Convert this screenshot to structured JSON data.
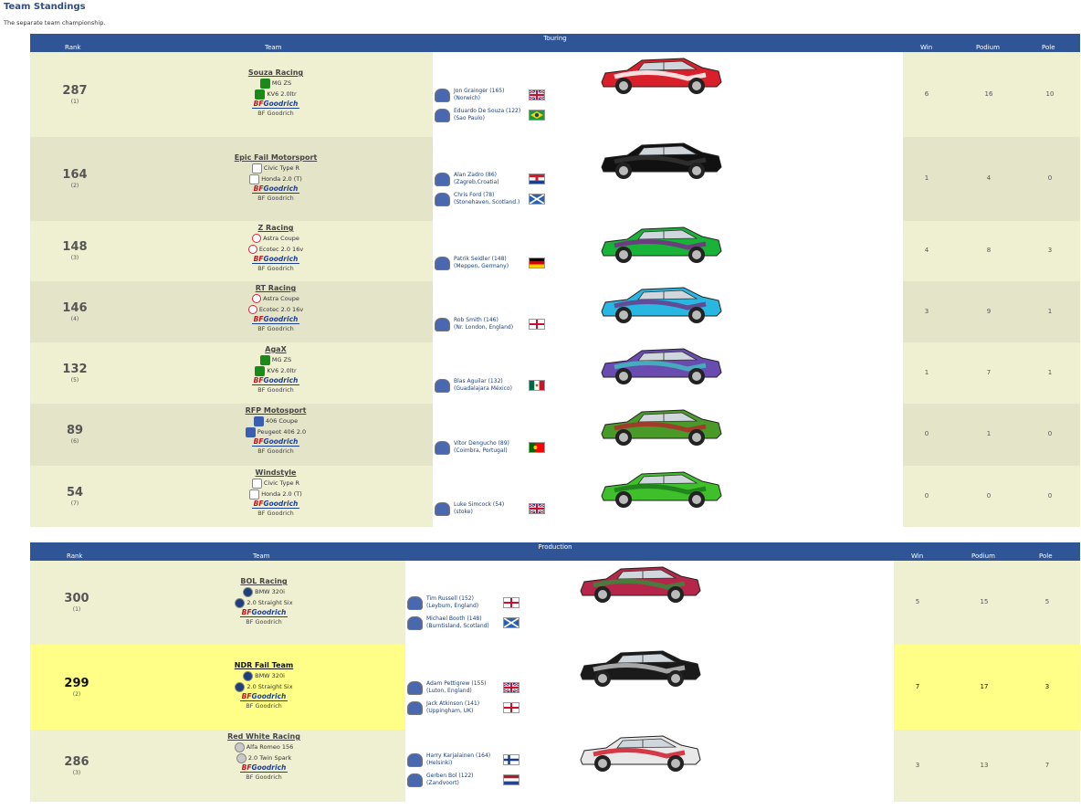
{
  "page": {
    "title": "Team Standings",
    "subtitle": "The separate team championship."
  },
  "touring": {
    "category": "Touring",
    "columns": {
      "rank": "Rank",
      "team": "Team",
      "win": "Win",
      "podium": "Podium",
      "pole": "Pole"
    },
    "rows": [
      {
        "points": "287",
        "position": "(1)",
        "team": "Souza Racing",
        "car_model": "MG ZS",
        "engine": "KV6 2.0ltr",
        "make_icon": "mg-icon",
        "tyre": "BF Goodrich",
        "drivers": [
          {
            "name": "Jon Grainger (165)",
            "location": "(Norwich)",
            "flag": "uk-flag"
          },
          {
            "name": "Eduardo De Souza (122)",
            "location": "(Sao Paulo)",
            "flag": "brazil-flag"
          }
        ],
        "win": "6",
        "podium": "16",
        "pole": "10",
        "car_colors": [
          "#d9202a",
          "#ffffff"
        ]
      },
      {
        "points": "164",
        "position": "(2)",
        "team": "Epic Fail Motorsport",
        "car_model": "Civic Type R",
        "engine": "Honda 2.0 (T)",
        "make_icon": "honda-icon",
        "tyre": "BF Goodrich",
        "drivers": [
          {
            "name": "Alan Zadro (86)",
            "location": "(Zagreb,Croatia)",
            "flag": "croatia-flag"
          },
          {
            "name": "Chris Ford (78)",
            "location": "(Stonehaven, Scotland.)",
            "flag": "scotland-flag"
          }
        ],
        "win": "1",
        "podium": "4",
        "pole": "0",
        "car_colors": [
          "#111111",
          "#333333"
        ]
      },
      {
        "points": "148",
        "position": "(3)",
        "team": "Z Racing",
        "car_model": "Astra Coupe",
        "engine": "Ecotec 2.0 16v",
        "make_icon": "vauxhall-icon",
        "tyre": "BF Goodrich",
        "drivers": [
          {
            "name": "Patrik Seidler (148)",
            "location": "(Meppen, Germany)",
            "flag": "germany-flag"
          }
        ],
        "win": "4",
        "podium": "8",
        "pole": "3",
        "car_colors": [
          "#19b33a",
          "#7a2a8a"
        ]
      },
      {
        "points": "146",
        "position": "(4)",
        "team": "RT Racing",
        "car_model": "Astra Coupe",
        "engine": "Ecotec 2.0 16v",
        "make_icon": "vauxhall-icon",
        "tyre": "BF Goodrich",
        "drivers": [
          {
            "name": "Rob Smith (146)",
            "location": "(Nr. London, England)",
            "flag": "england-flag"
          }
        ],
        "win": "3",
        "podium": "9",
        "pole": "1",
        "car_colors": [
          "#29b6e0",
          "#6a3a8a"
        ]
      },
      {
        "points": "132",
        "position": "(5)",
        "team": "AgaX",
        "car_model": "MG ZS",
        "engine": "KV6 2.0ltr",
        "make_icon": "mg-icon",
        "tyre": "BF Goodrich",
        "drivers": [
          {
            "name": "Blas Aguilar (132)",
            "location": "(Guadalajara México)",
            "flag": "mexico-flag"
          }
        ],
        "win": "1",
        "podium": "7",
        "pole": "1",
        "car_colors": [
          "#6a4bb0",
          "#3fbcc0"
        ]
      },
      {
        "points": "89",
        "position": "(6)",
        "team": "RFP Motosport",
        "car_model": "406 Coupe",
        "engine": "Peugeot 406 2.0",
        "make_icon": "peugeot-icon",
        "tyre": "BF Goodrich",
        "drivers": [
          {
            "name": "Vítor Dengucho (89)",
            "location": "(Coimbra, Portugal)",
            "flag": "portugal-flag"
          }
        ],
        "win": "0",
        "podium": "1",
        "pole": "0",
        "car_colors": [
          "#4a9a2a",
          "#b02a2a"
        ]
      },
      {
        "points": "54",
        "position": "(7)",
        "team": "Windstyle",
        "car_model": "Civic Type R",
        "engine": "Honda 2.0 (T)",
        "make_icon": "honda-icon",
        "tyre": "BF Goodrich",
        "drivers": [
          {
            "name": "Luke Simcock (54)",
            "location": "(stoke)",
            "flag": "uk-flag"
          }
        ],
        "win": "0",
        "podium": "0",
        "pole": "0",
        "car_colors": [
          "#3fbf2a",
          "#1a7a1a"
        ]
      }
    ]
  },
  "production": {
    "category": "Production",
    "columns": {
      "rank": "Rank",
      "team": "Team",
      "win": "Win",
      "podium": "Podium",
      "pole": "Pole"
    },
    "rows": [
      {
        "points": "300",
        "position": "(1)",
        "team": "BOL Racing",
        "car_model": "BMW 320i",
        "engine": "2.0 Straight Six",
        "make_icon": "bmw-icon",
        "tyre": "BF Goodrich",
        "drivers": [
          {
            "name": "Tim Russell (152)",
            "location": "(Leyburn, England)",
            "flag": "england-flag"
          },
          {
            "name": "Michael Booth (148)",
            "location": "(Burntisland, Scotland)",
            "flag": "scotland-flag"
          }
        ],
        "win": "5",
        "podium": "15",
        "pole": "5",
        "car_colors": [
          "#b5264a",
          "#3a8a3a"
        ]
      },
      {
        "points": "299",
        "position": "(2)",
        "team": "NDR Fail Team",
        "car_model": "BMW 320i",
        "engine": "2.0 Straight Six",
        "make_icon": "bmw-icon",
        "tyre": "BF Goodrich",
        "drivers": [
          {
            "name": "Adam Pettigrew (155)",
            "location": "(Luton, England)",
            "flag": "uk-flag"
          },
          {
            "name": "Jack Atkinson (141)",
            "location": "(Uppingham, UK)",
            "flag": "england-flag"
          }
        ],
        "win": "7",
        "podium": "17",
        "pole": "3",
        "car_colors": [
          "#1a1a1a",
          "#c0c0c0"
        ]
      },
      {
        "points": "286",
        "position": "(3)",
        "team": "Red White Racing",
        "car_model": "Alfa Romeo 156",
        "engine": "2.0 Twin Spark",
        "make_icon": "alfa-icon",
        "tyre": "BF Goodrich",
        "drivers": [
          {
            "name": "Harry Karjalainen (164)",
            "location": "(Helsinki)",
            "flag": "finland-flag"
          },
          {
            "name": "Gerben Bol (122)",
            "location": "(Zandvoort)",
            "flag": "netherlands-flag"
          }
        ],
        "win": "3",
        "podium": "13",
        "pole": "7",
        "car_colors": [
          "#e8e8e8",
          "#d11a2a"
        ]
      }
    ]
  }
}
